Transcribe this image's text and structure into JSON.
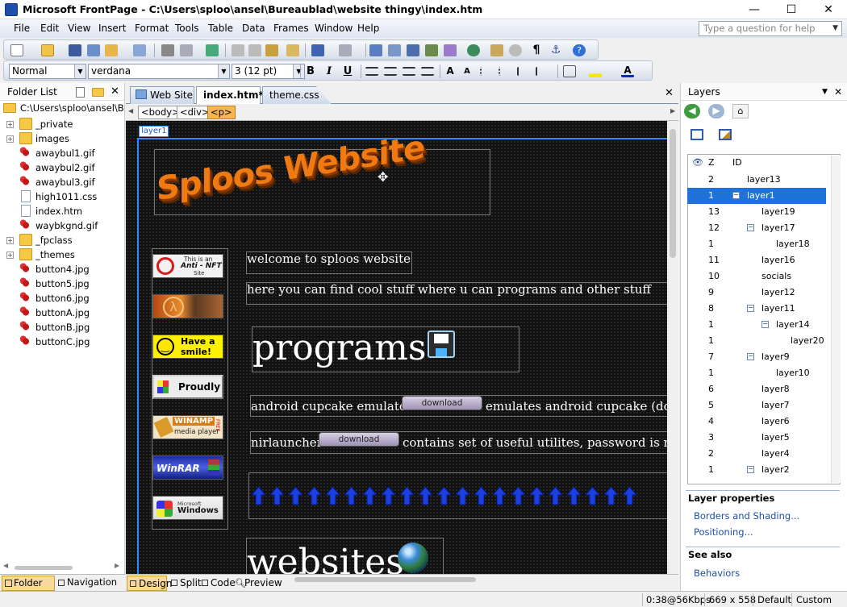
{
  "window": {
    "title": "Microsoft FrontPage - C:\\Users\\sploo\\ansel\\Bureaublad\\website thingy\\index.htm",
    "min": "—",
    "max": "☐",
    "close": "✕"
  },
  "menu": [
    "File",
    "Edit",
    "View",
    "Insert",
    "Format",
    "Tools",
    "Table",
    "Data",
    "Frames",
    "Window",
    "Help"
  ],
  "help_placeholder": "Type a question for help",
  "format_toolbar": {
    "style": "Normal",
    "font": "verdana",
    "size": "3  (12 pt)",
    "bold": "B",
    "italic": "I",
    "underline": "U"
  },
  "folder_list": {
    "title": "Folder List",
    "root": "C:\\Users\\sploo\\ansel\\Bure",
    "items": [
      {
        "name": "_private",
        "type": "folder",
        "exp": "+"
      },
      {
        "name": "images",
        "type": "folder",
        "exp": "+"
      },
      {
        "name": "awaybul1.gif",
        "type": "gif"
      },
      {
        "name": "awaybul2.gif",
        "type": "gif"
      },
      {
        "name": "awaybul3.gif",
        "type": "gif"
      },
      {
        "name": "high1011.css",
        "type": "file"
      },
      {
        "name": "index.htm",
        "type": "file"
      },
      {
        "name": "waybkgnd.gif",
        "type": "gif"
      },
      {
        "name": "_fpclass",
        "type": "folder",
        "exp": "+"
      },
      {
        "name": "_themes",
        "type": "folder",
        "exp": "+"
      },
      {
        "name": "button4.jpg",
        "type": "gif"
      },
      {
        "name": "button5.jpg",
        "type": "gif"
      },
      {
        "name": "button6.jpg",
        "type": "gif"
      },
      {
        "name": "buttonA.jpg",
        "type": "gif"
      },
      {
        "name": "buttonB.jpg",
        "type": "gif"
      },
      {
        "name": "buttonC.jpg",
        "type": "gif"
      }
    ]
  },
  "left_tabs": {
    "folder": "Folder List",
    "nav": "Navigation"
  },
  "doc_tabs": {
    "site": "Web Site",
    "index": "index.htm*",
    "theme": "theme.css"
  },
  "crumbs": {
    "body": "<body>",
    "div": "<div>",
    "p": "<p>"
  },
  "layer_label": "layer1",
  "page": {
    "logo": "Sploos Website",
    "welcome": "welcome to sploos website",
    "intro": "here you can find cool stuff where u can programs and other stuff",
    "programs": "programs",
    "item1_name": "android cupcake emulator",
    "item1_desc": "emulates android cupcake (dont",
    "item2_name": "nirlauncher",
    "item2_desc": "contains set of useful utilites, password is nirso",
    "download": "download",
    "websites": "websites",
    "badges": {
      "antinft_top": "This is an",
      "antinft_mid": "Anti - NFT",
      "antinft_bot": "Site",
      "smile1": "Have a",
      "smile2": "smile!",
      "proudly": "Proudly",
      "winamp": "WINAMP",
      "winamp_sub": "media player",
      "winamp_side": "FREE",
      "winrar": "WinRAR",
      "winxp_ms": "Microsoft",
      "winxp": "Windows"
    }
  },
  "view_tabs": {
    "design": "Design",
    "split": "Split",
    "code": "Code",
    "preview": "Preview"
  },
  "layers": {
    "title": "Layers",
    "col_z": "Z",
    "col_id": "ID",
    "rows": [
      {
        "z": "2",
        "id": "layer13",
        "mn": "",
        "lvl": 0
      },
      {
        "z": "1",
        "id": "layer1",
        "mn": "⊟",
        "lvl": 0,
        "sel": true
      },
      {
        "z": "13",
        "id": "layer19",
        "mn": "",
        "lvl": 1
      },
      {
        "z": "12",
        "id": "layer17",
        "mn": "⊟",
        "lvl": 1
      },
      {
        "z": "1",
        "id": "layer18",
        "mn": "",
        "lvl": 2
      },
      {
        "z": "11",
        "id": "layer16",
        "mn": "",
        "lvl": 1
      },
      {
        "z": "10",
        "id": "socials",
        "mn": "",
        "lvl": 1
      },
      {
        "z": "9",
        "id": "layer12",
        "mn": "",
        "lvl": 1
      },
      {
        "z": "8",
        "id": "layer11",
        "mn": "⊟",
        "lvl": 1
      },
      {
        "z": "1",
        "id": "layer14",
        "mn": "⊟",
        "lvl": 2
      },
      {
        "z": "1",
        "id": "layer20",
        "mn": "",
        "lvl": 3
      },
      {
        "z": "7",
        "id": "layer9",
        "mn": "⊟",
        "lvl": 1
      },
      {
        "z": "1",
        "id": "layer10",
        "mn": "",
        "lvl": 2
      },
      {
        "z": "6",
        "id": "layer8",
        "mn": "",
        "lvl": 1
      },
      {
        "z": "5",
        "id": "layer7",
        "mn": "",
        "lvl": 1
      },
      {
        "z": "4",
        "id": "layer6",
        "mn": "",
        "lvl": 1
      },
      {
        "z": "3",
        "id": "layer5",
        "mn": "",
        "lvl": 1
      },
      {
        "z": "2",
        "id": "layer4",
        "mn": "",
        "lvl": 1
      },
      {
        "z": "1",
        "id": "layer2",
        "mn": "⊟",
        "lvl": 1
      }
    ],
    "props_title": "Layer properties",
    "borders": "Borders and Shading...",
    "positioning": "Positioning...",
    "see_also": "See also",
    "behaviors": "Behaviors"
  },
  "status": {
    "time": "0:38@56Kbps",
    "size": "669 x 558",
    "mode": "Default",
    "custom": "Custom"
  }
}
